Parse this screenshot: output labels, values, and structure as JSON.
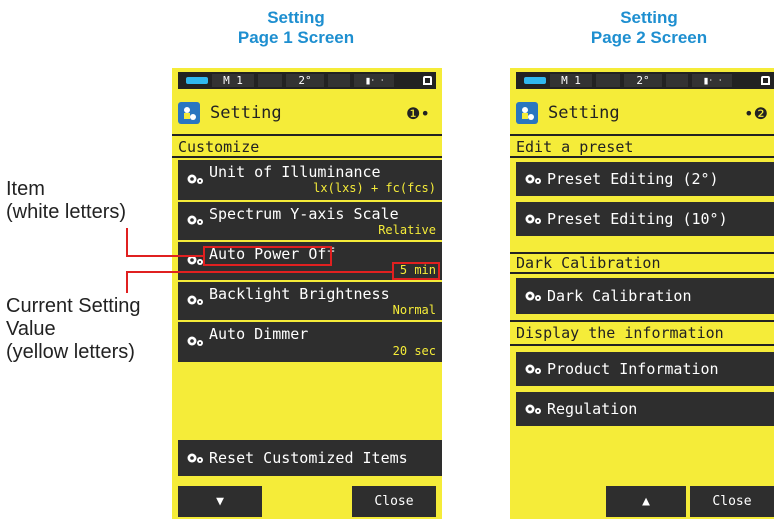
{
  "captions": {
    "page1": [
      "Setting",
      "Page 1 Screen"
    ],
    "page2": [
      "Setting",
      "Page 2 Screen"
    ]
  },
  "annotations": {
    "item": [
      "Item",
      "(white letters)"
    ],
    "current_value": [
      "Current Setting",
      "Value",
      "(yellow letters)"
    ]
  },
  "status_bar": {
    "mode": "M 1",
    "angle": "2°"
  },
  "page1": {
    "title": "Setting",
    "page_indicator": "❶•",
    "section": "Customize",
    "items": [
      {
        "label": "Unit of Illuminance",
        "value": "lx(lxs) + fc(fcs)"
      },
      {
        "label": "Spectrum Y-axis Scale",
        "value": "Relative"
      },
      {
        "label": "Auto Power Off",
        "value": "5 min"
      },
      {
        "label": "Backlight Brightness",
        "value": "Normal"
      },
      {
        "label": "Auto Dimmer",
        "value": "20 sec"
      }
    ],
    "reset_label": "Reset Customized Items",
    "nav_down": "▼",
    "close_label": "Close"
  },
  "page2": {
    "title": "Setting",
    "page_indicator": "•❷",
    "sections": {
      "preset": "Edit a preset",
      "dark": "Dark Calibration",
      "info": "Display the information"
    },
    "items": {
      "preset2": "Preset Editing (2°)",
      "preset10": "Preset Editing (10°)",
      "dark": "Dark Calibration",
      "product": "Product Information",
      "regulation": "Regulation"
    },
    "nav_up": "▲",
    "close_label": "Close"
  },
  "colors": {
    "screen": "#f5ec39",
    "item_bg": "#2e2e2e",
    "value": "#f5ec39",
    "callout": "#e02020",
    "caption": "#1e8fd0"
  }
}
